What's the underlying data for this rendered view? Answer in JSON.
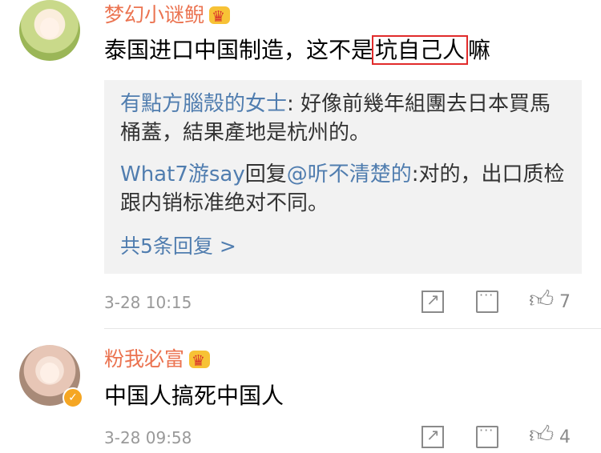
{
  "comments": [
    {
      "username": "梦幻小谜鲵",
      "text_before": "泰国进口中国制造，这不是",
      "text_highlight": "坑自己人",
      "text_after": "嘛",
      "replies": [
        {
          "name": "有點方腦殼的女士",
          "text": ": 好像前幾年組團去日本買馬桶蓋，結果產地是杭州的。"
        },
        {
          "name": "What7游say",
          "reply_label": "回复",
          "mention": "@听不清楚的",
          "text": ":对的，出口质检跟内销标准绝对不同。"
        }
      ],
      "more_replies": "共5条回复 >",
      "time": "3-28 10:15",
      "likes": "7"
    },
    {
      "username": "粉我必富",
      "text": "中国人搞死中国人",
      "time": "3-28 09:58",
      "likes": "4"
    }
  ],
  "icons": {
    "share": "share-icon",
    "comment": "comment-icon",
    "like": "thumbs-up-icon",
    "vip": "crown-icon",
    "verified": "verified-badge"
  },
  "colors": {
    "username": "#eb7350",
    "link": "#507daf",
    "highlight_border": "#e12b2b",
    "meta": "#999999",
    "reply_bg": "#f2f2f2"
  }
}
